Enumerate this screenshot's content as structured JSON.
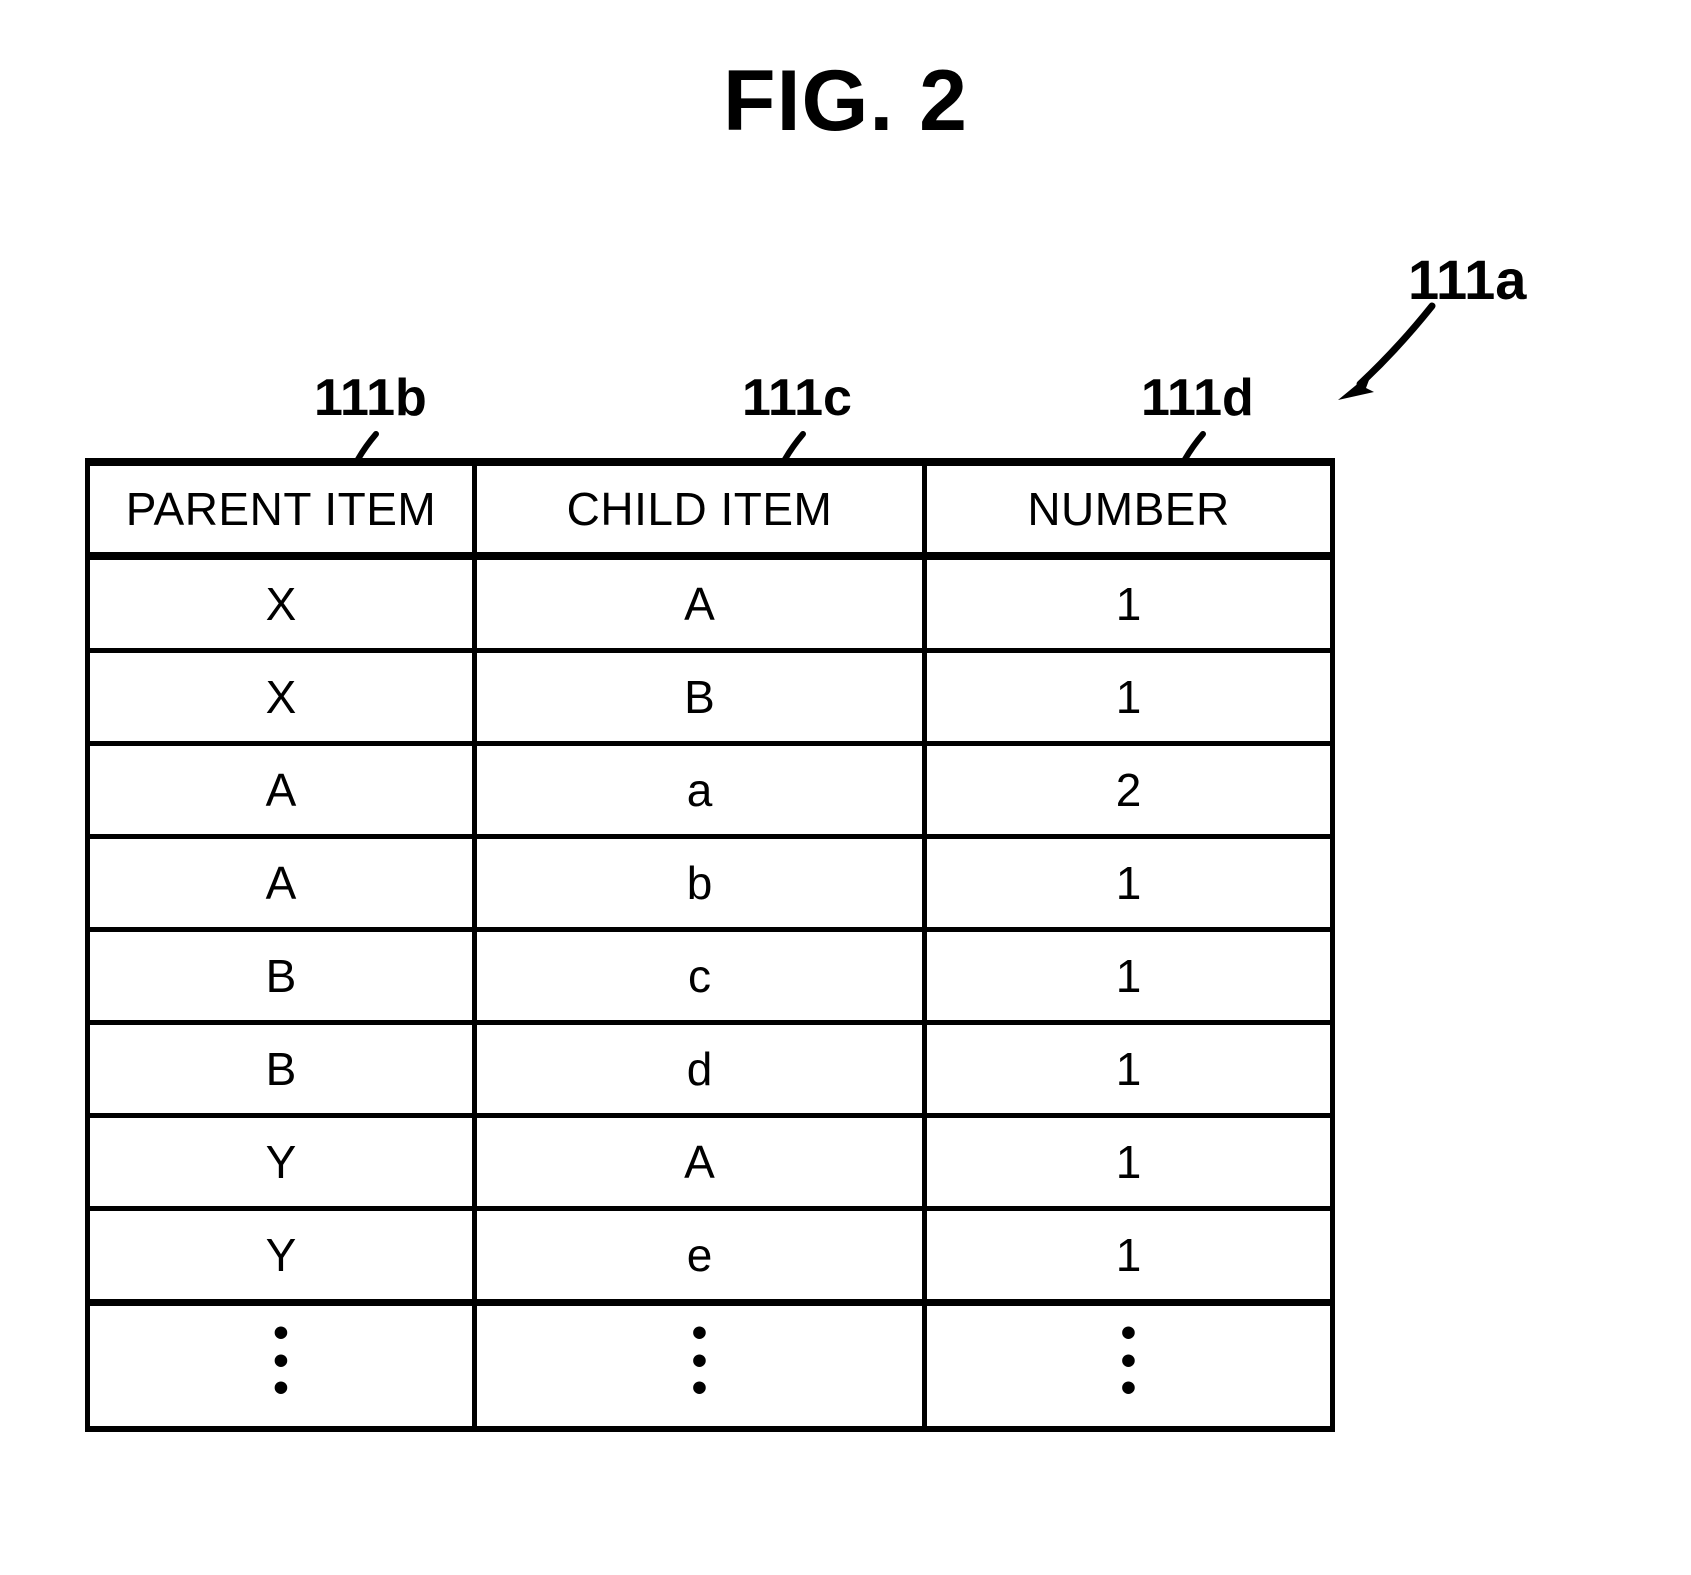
{
  "figure": {
    "title": "FIG. 2",
    "table_callout": "111a",
    "column_callouts": {
      "parent": "111b",
      "child": "111c",
      "number": "111d"
    },
    "ellipsis": "⋮"
  },
  "table": {
    "headers": [
      "PARENT ITEM",
      "CHILD ITEM",
      "NUMBER"
    ],
    "rows": [
      {
        "parent": "X",
        "child": "A",
        "number": "1"
      },
      {
        "parent": "X",
        "child": "B",
        "number": "1"
      },
      {
        "parent": "A",
        "child": "a",
        "number": "2"
      },
      {
        "parent": "A",
        "child": "b",
        "number": "1"
      },
      {
        "parent": "B",
        "child": "c",
        "number": "1"
      },
      {
        "parent": "B",
        "child": "d",
        "number": "1"
      },
      {
        "parent": "Y",
        "child": "A",
        "number": "1"
      },
      {
        "parent": "Y",
        "child": "e",
        "number": "1"
      }
    ],
    "continuation_row": {
      "parent": "⋮",
      "child": "⋮",
      "number": "⋮"
    }
  },
  "style": {
    "line_color": "#000000",
    "background": "#ffffff"
  }
}
